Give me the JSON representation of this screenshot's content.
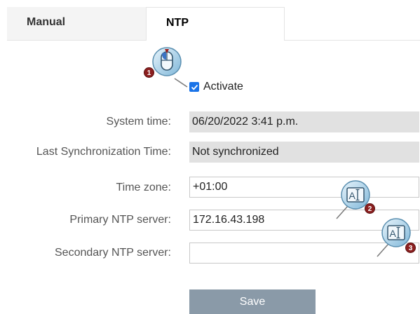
{
  "tabs": [
    {
      "label": "Manual",
      "active": false
    },
    {
      "label": "NTP",
      "active": true
    }
  ],
  "activate": {
    "label": "Activate",
    "checked": true
  },
  "form": {
    "system_time": {
      "label": "System time:",
      "value": "06/20/2022 3:41 p.m."
    },
    "last_sync": {
      "label": "Last Synchronization Time:",
      "value": "Not synchronized"
    },
    "time_zone": {
      "label": "Time zone:",
      "value": "+01:00"
    },
    "primary_ntp": {
      "label": "Primary NTP server:",
      "value": "172.16.43.198"
    },
    "secondary_ntp": {
      "label": "Secondary NTP server:",
      "value": ""
    }
  },
  "save_label": "Save",
  "callouts": [
    {
      "number": "1",
      "icon": "mouse-click-icon"
    },
    {
      "number": "2",
      "icon": "text-input-icon"
    },
    {
      "number": "3",
      "icon": "text-input-icon"
    }
  ],
  "colors": {
    "checkbox": "#1a73e8",
    "badge": "#8b1f1f",
    "save_button": "#8a9aa8",
    "readonly_field": "#e1e1e1"
  }
}
